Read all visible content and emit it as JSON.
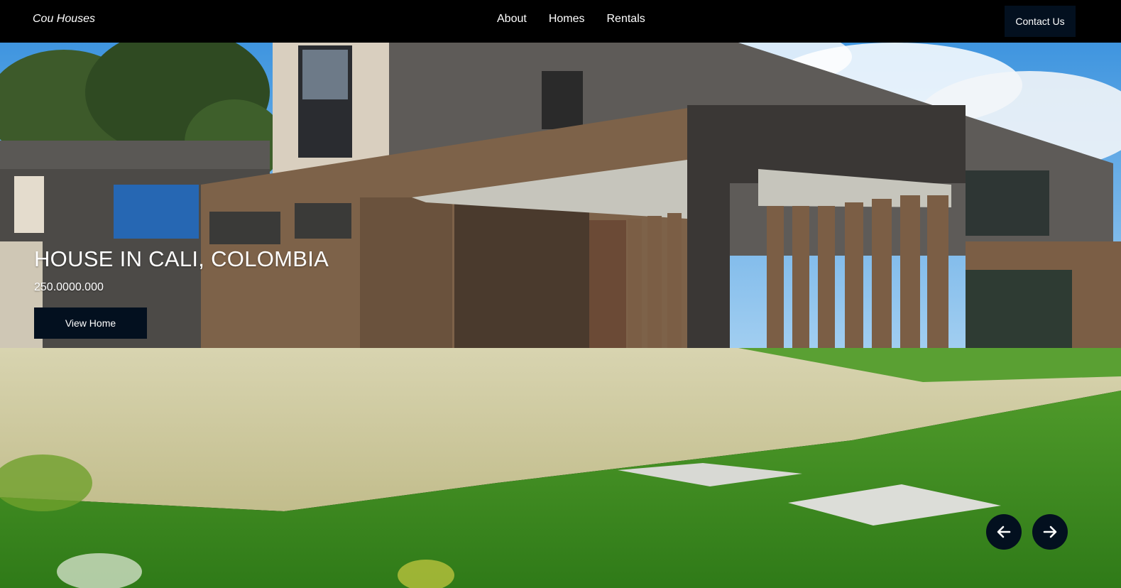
{
  "header": {
    "logo": "Cou Houses",
    "nav": [
      "About",
      "Homes",
      "Rentals"
    ],
    "contact_label": "Contact Us"
  },
  "hero": {
    "title": "HOUSE IN CALI, COLOMBIA",
    "price": "250.0000.000",
    "view_label": "View Home",
    "prev_icon": "arrow-left-icon",
    "next_icon": "arrow-right-icon"
  },
  "colors": {
    "nav_bg": "#000000",
    "button_bg": "#03101f",
    "text": "#ffffff"
  }
}
